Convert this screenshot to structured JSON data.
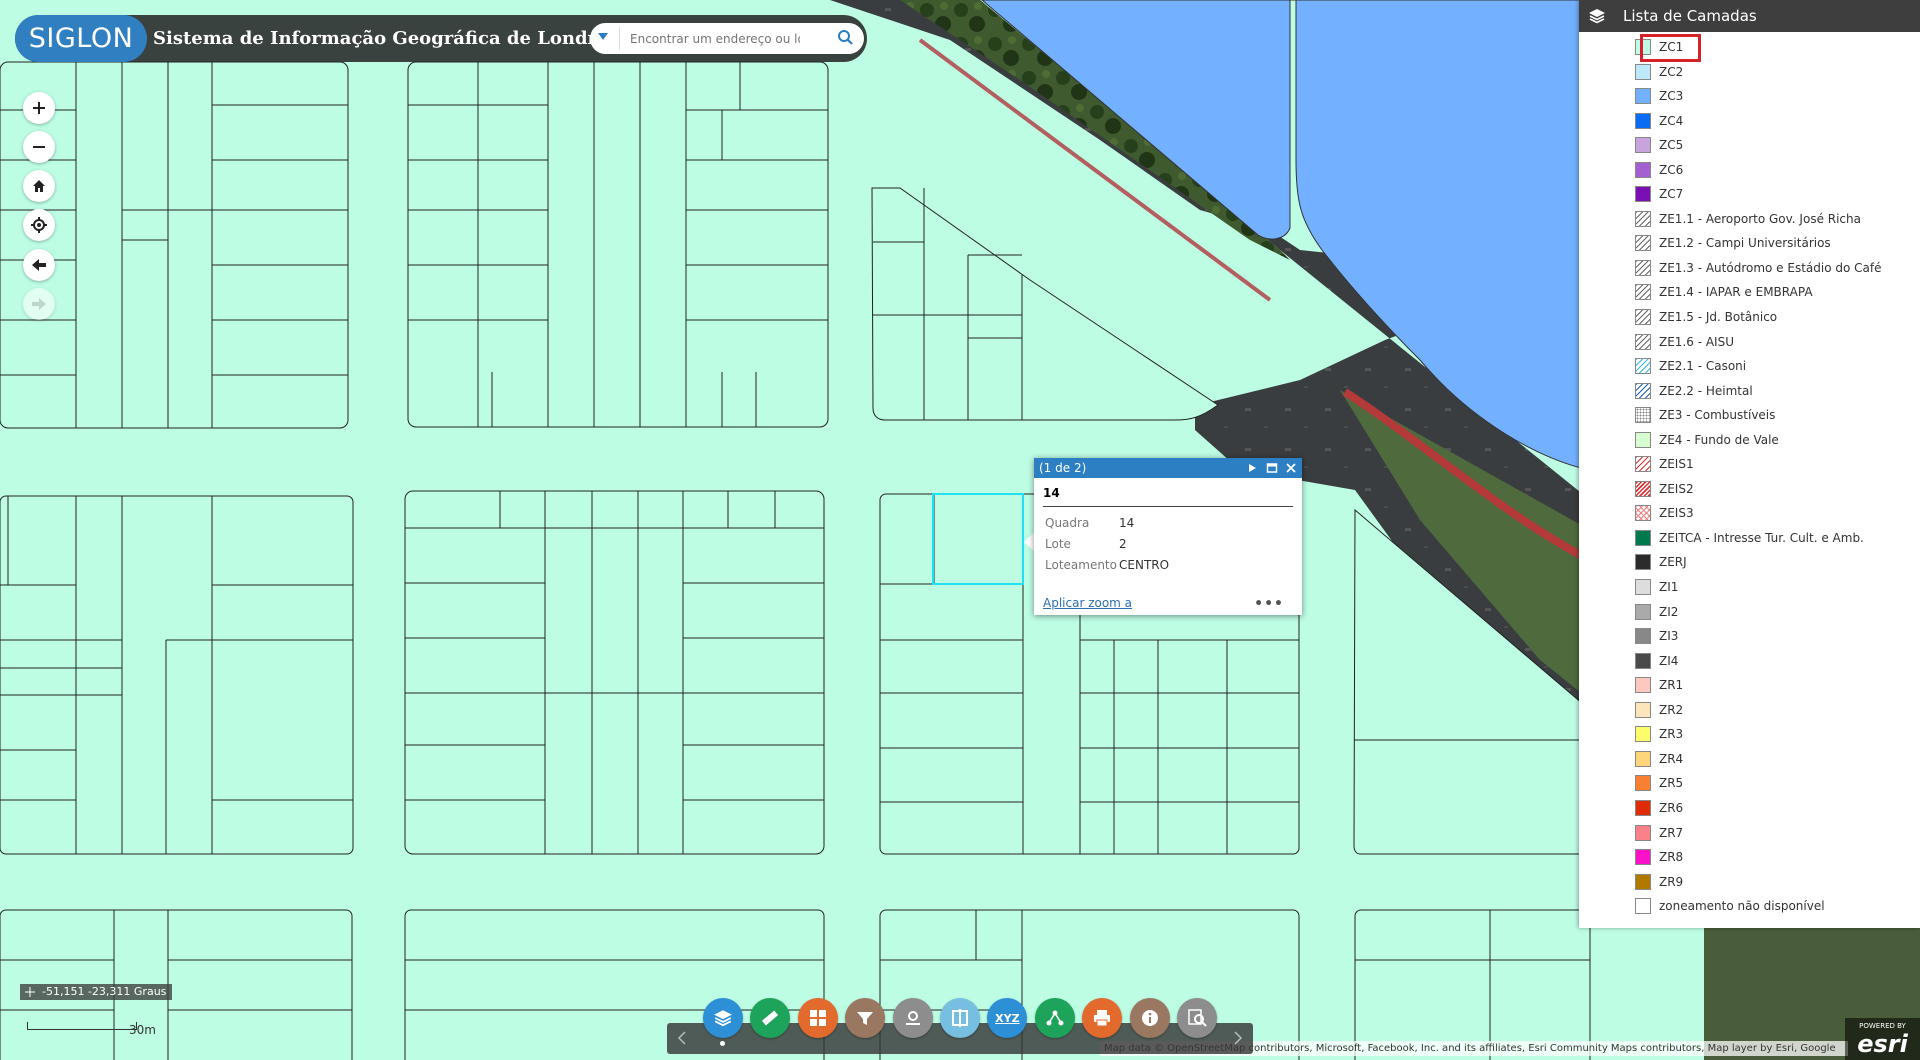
{
  "header": {
    "logo_text": "SIGLON",
    "app_title": "Sistema de Informação Geográfica de Londrina",
    "search_placeholder": "Encontrar um endereço ou local"
  },
  "map": {
    "coords_text": "-51,151 -23,311 Graus",
    "scale_label": "30m",
    "attribution": "Map data © OpenStreetMap contributors, Microsoft, Facebook, Inc. and its affiliates, Esri Community Maps contributors, Map layer by Esri, Google",
    "esri_powered": "POWERED BY",
    "esri_name": "esri"
  },
  "popup": {
    "counter": "(1 de 2)",
    "title": "14",
    "fields": [
      {
        "key": "Quadra",
        "value": "14"
      },
      {
        "key": "Lote",
        "value": "2"
      },
      {
        "key": "Loteamento",
        "value": "CENTRO"
      }
    ],
    "zoom_link": "Aplicar zoom a",
    "more": "•••"
  },
  "layers_panel": {
    "title": "Lista de Camadas",
    "items": [
      {
        "label": "ZC1",
        "color": "#bdfde4",
        "pattern": "solid"
      },
      {
        "label": "ZC2",
        "color": "#bfe8fb",
        "pattern": "solid"
      },
      {
        "label": "ZC3",
        "color": "#73b0ff",
        "pattern": "solid"
      },
      {
        "label": "ZC4",
        "color": "#0a6cf2",
        "pattern": "solid"
      },
      {
        "label": "ZC5",
        "color": "#c8a4dc",
        "pattern": "solid"
      },
      {
        "label": "ZC6",
        "color": "#a460d0",
        "pattern": "solid"
      },
      {
        "label": "ZC7",
        "color": "#7a0fb3",
        "pattern": "solid"
      },
      {
        "label": "ZE1.1 - Aeroporto Gov. José Richa",
        "color": "#666666",
        "pattern": "hatch"
      },
      {
        "label": "ZE1.2 - Campi Universitários",
        "color": "#666666",
        "pattern": "hatch"
      },
      {
        "label": "ZE1.3 - Autódromo e Estádio do Café",
        "color": "#666666",
        "pattern": "hatch"
      },
      {
        "label": "ZE1.4 - IAPAR e EMBRAPA",
        "color": "#666666",
        "pattern": "hatch"
      },
      {
        "label": "ZE1.5 - Jd. Botânico",
        "color": "#666666",
        "pattern": "hatch"
      },
      {
        "label": "ZE1.6 - AISU",
        "color": "#666666",
        "pattern": "hatch"
      },
      {
        "label": "ZE2.1 - Casoni",
        "color": "#3ab6e6",
        "pattern": "hatch"
      },
      {
        "label": "ZE2.2 - Heimtal",
        "color": "#1f5fb0",
        "pattern": "hatch"
      },
      {
        "label": "ZE3 - Combustíveis",
        "color": "#888888",
        "pattern": "dots"
      },
      {
        "label": "ZE4 - Fundo de Vale",
        "color": "#d7fdd0",
        "pattern": "solid"
      },
      {
        "label": "ZEIS1",
        "color": "#e03030",
        "pattern": "hatch"
      },
      {
        "label": "ZEIS2",
        "color": "#e03030",
        "pattern": "hatch2"
      },
      {
        "label": "ZEIS3",
        "color": "#f08080",
        "pattern": "cross"
      },
      {
        "label": "ZEITCA - Intresse Tur. Cult. e Amb.",
        "color": "#007a4c",
        "pattern": "solid"
      },
      {
        "label": "ZERJ",
        "color": "#2b2b2b",
        "pattern": "solid"
      },
      {
        "label": "ZI1",
        "color": "#dddddd",
        "pattern": "solid"
      },
      {
        "label": "ZI2",
        "color": "#aaaaaa",
        "pattern": "solid"
      },
      {
        "label": "ZI3",
        "color": "#888888",
        "pattern": "solid"
      },
      {
        "label": "ZI4",
        "color": "#4a4a4a",
        "pattern": "solid"
      },
      {
        "label": "ZR1",
        "color": "#fcc8c0",
        "pattern": "solid"
      },
      {
        "label": "ZR2",
        "color": "#fde5bb",
        "pattern": "solid"
      },
      {
        "label": "ZR3",
        "color": "#fdfc6a",
        "pattern": "solid"
      },
      {
        "label": "ZR4",
        "color": "#fdd57a",
        "pattern": "solid"
      },
      {
        "label": "ZR5",
        "color": "#f98033",
        "pattern": "solid"
      },
      {
        "label": "ZR6",
        "color": "#e02c05",
        "pattern": "solid"
      },
      {
        "label": "ZR7",
        "color": "#f9818a",
        "pattern": "solid"
      },
      {
        "label": "ZR8",
        "color": "#fa12c8",
        "pattern": "solid"
      },
      {
        "label": "ZR9",
        "color": "#b07a00",
        "pattern": "solid"
      },
      {
        "label": "zoneamento não disponível",
        "color": "#ffffff",
        "pattern": "solid"
      }
    ]
  },
  "toolbar": {
    "tools": [
      {
        "name": "layers",
        "color": "#2d8fd5"
      },
      {
        "name": "measure",
        "color": "#1ea35a"
      },
      {
        "name": "basemap-gallery",
        "color": "#e26a2c"
      },
      {
        "name": "filter",
        "color": "#9a7760"
      },
      {
        "name": "draw",
        "color": "#8d8d8d"
      },
      {
        "name": "swipe",
        "color": "#76bfe0"
      },
      {
        "name": "xyz-coordinates",
        "color": "#2d8fd5"
      },
      {
        "name": "share",
        "color": "#1ea35a"
      },
      {
        "name": "print",
        "color": "#e26a2c"
      },
      {
        "name": "about",
        "color": "#9a7760"
      },
      {
        "name": "query",
        "color": "#8d8d8d"
      }
    ],
    "xyz_label": "XYZ"
  }
}
